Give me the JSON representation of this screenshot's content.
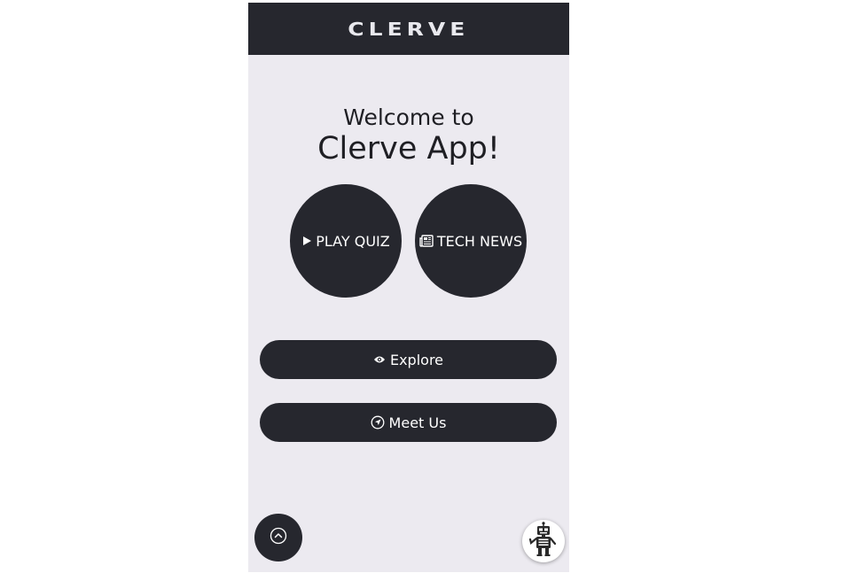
{
  "header": {
    "logo_text": "CLERVE"
  },
  "welcome": {
    "line1": "Welcome to",
    "line2": "Clerve App!"
  },
  "actions": {
    "play_quiz": {
      "label": "PLAY QUIZ",
      "icon": "play-icon"
    },
    "tech_news": {
      "label": "TECH NEWS",
      "icon": "newspaper-icon"
    }
  },
  "buttons": {
    "explore": {
      "label": "Explore",
      "icon": "eye-icon"
    },
    "meet_us": {
      "label": "Meet Us",
      "icon": "compass-icon"
    }
  },
  "floating": {
    "scroll_top_icon": "chevron-up-icon",
    "bot_icon": "robot-icon"
  },
  "colors": {
    "dark": "#26272e",
    "background": "#eceaf0",
    "text": "#1f1f24"
  }
}
